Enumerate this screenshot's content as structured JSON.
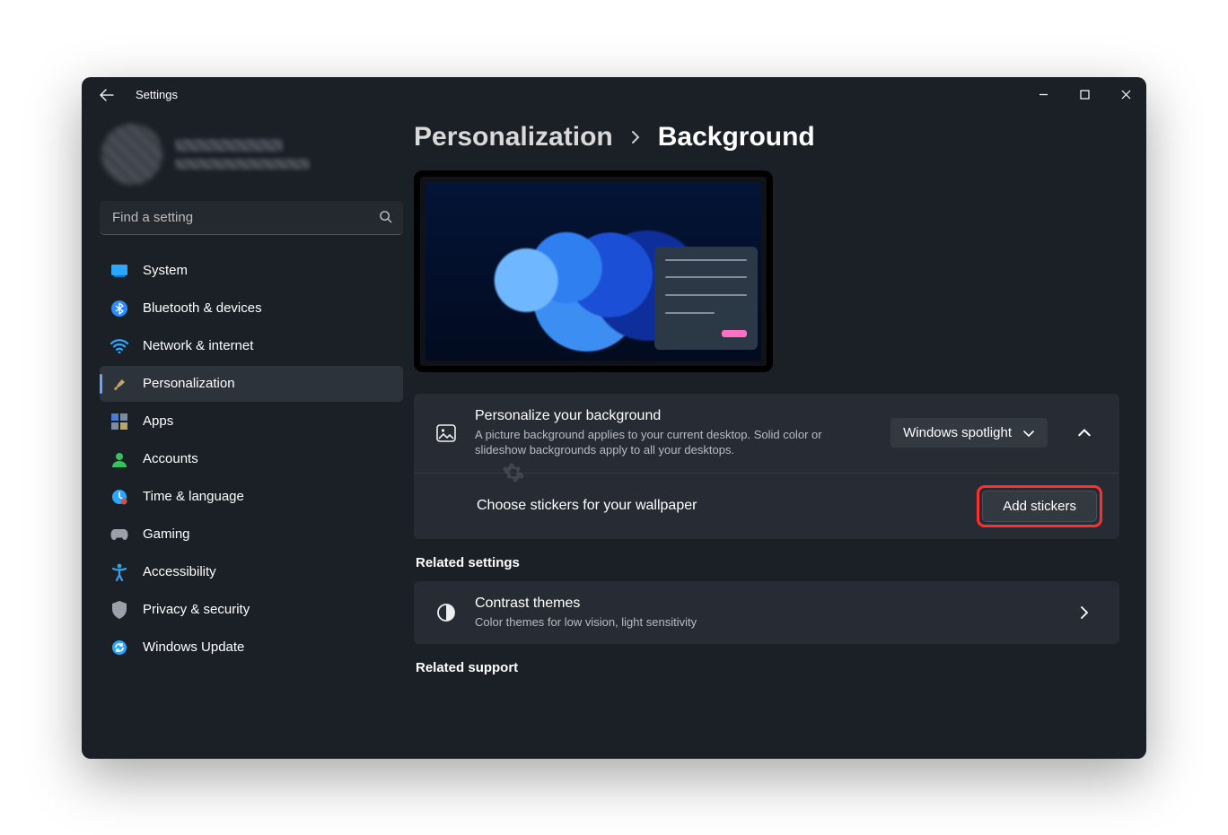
{
  "window": {
    "title": "Settings"
  },
  "search": {
    "placeholder": "Find a setting"
  },
  "sidebar": {
    "items": [
      {
        "label": "System",
        "icon": "system"
      },
      {
        "label": "Bluetooth & devices",
        "icon": "bluetooth"
      },
      {
        "label": "Network & internet",
        "icon": "wifi"
      },
      {
        "label": "Personalization",
        "icon": "brush",
        "active": true
      },
      {
        "label": "Apps",
        "icon": "apps"
      },
      {
        "label": "Accounts",
        "icon": "accounts"
      },
      {
        "label": "Time & language",
        "icon": "time"
      },
      {
        "label": "Gaming",
        "icon": "gaming"
      },
      {
        "label": "Accessibility",
        "icon": "accessibility"
      },
      {
        "label": "Privacy & security",
        "icon": "privacy"
      },
      {
        "label": "Windows Update",
        "icon": "update"
      }
    ]
  },
  "breadcrumb": {
    "parent": "Personalization",
    "current": "Background"
  },
  "personalize": {
    "title": "Personalize your background",
    "desc": "A picture background applies to your current desktop. Solid color or slideshow backgrounds apply to all your desktops.",
    "dropdown_value": "Windows spotlight"
  },
  "stickers": {
    "title": "Choose stickers for your wallpaper",
    "button": "Add stickers"
  },
  "related_settings": {
    "heading": "Related settings",
    "contrast_title": "Contrast themes",
    "contrast_desc": "Color themes for low vision, light sensitivity"
  },
  "related_support": {
    "heading": "Related support"
  }
}
